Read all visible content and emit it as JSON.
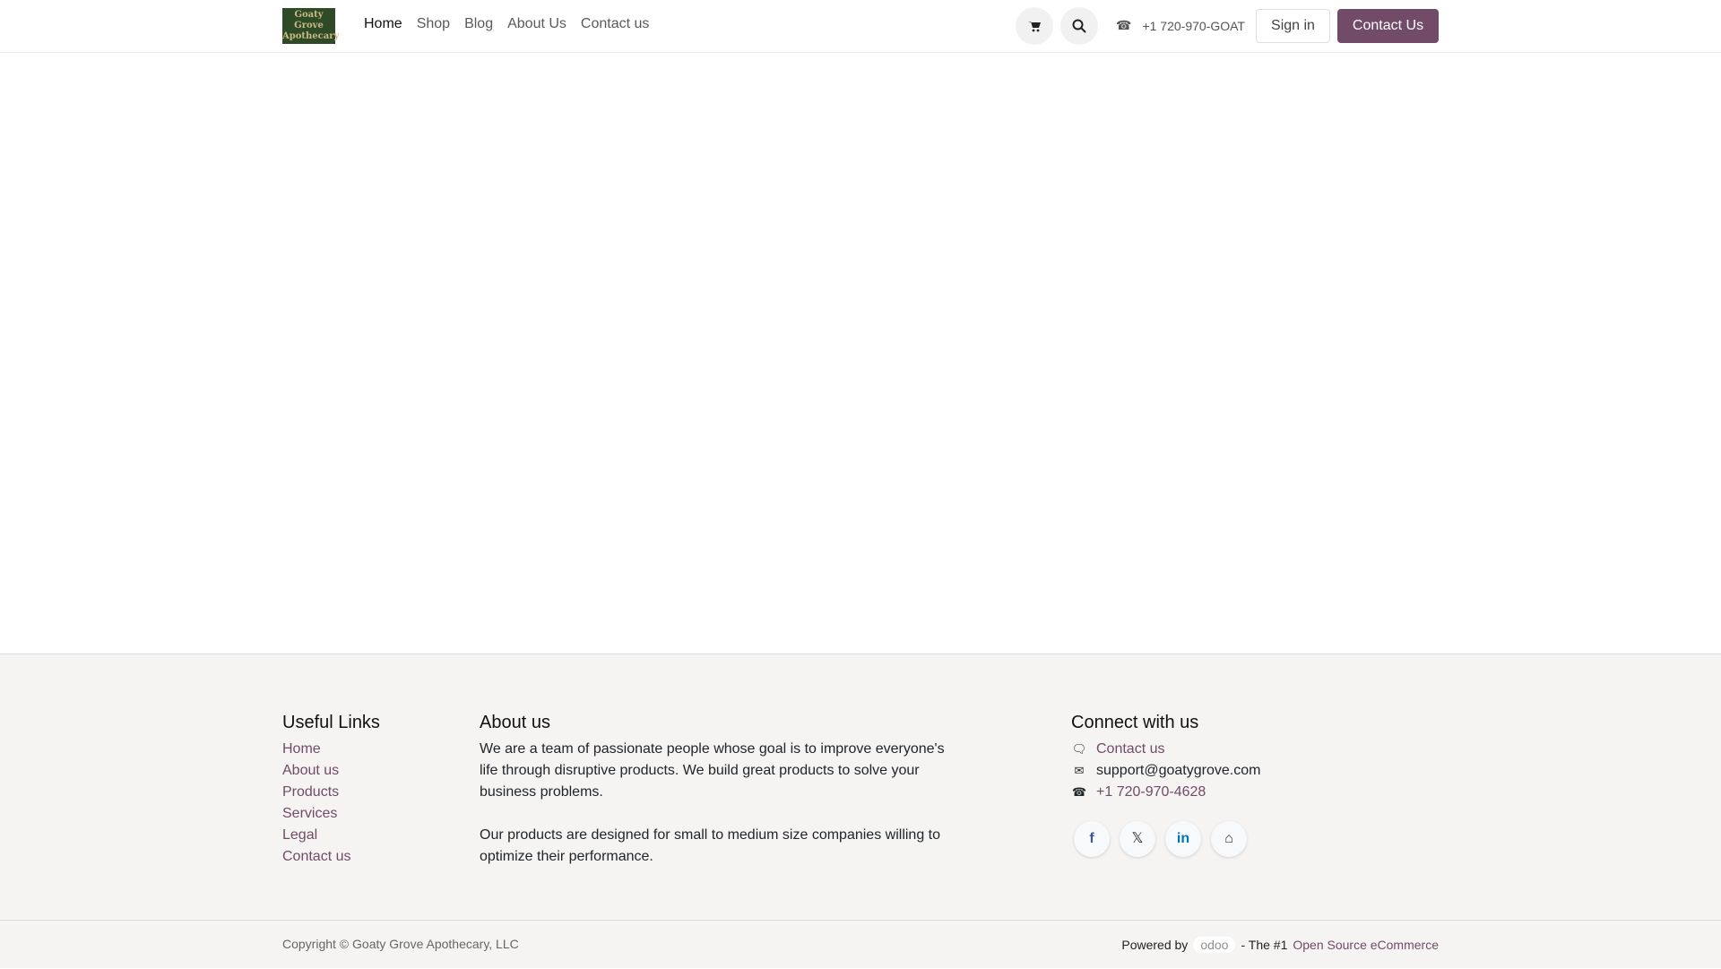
{
  "header": {
    "logo_text": "Goaty Grove Apothecary",
    "nav": [
      "Home",
      "Shop",
      "Blog",
      "About Us",
      "Contact us"
    ],
    "phone": "+1 720-970-GOAT",
    "sign_in": "Sign in",
    "contact_button": "Contact Us"
  },
  "footer": {
    "useful_links": {
      "title": "Useful Links",
      "items": [
        "Home",
        "About us",
        "Products",
        "Services",
        "Legal",
        "Contact us"
      ]
    },
    "about": {
      "title": "About us",
      "p1": "We are a team of passionate people whose goal is to improve everyone's life through disruptive products. We build great products to solve your business problems.",
      "p2": "Our products are designed for small to medium size companies willing to optimize their performance."
    },
    "connect": {
      "title": "Connect with us",
      "contact": "Contact us",
      "email": "support@goatygrove.com",
      "phone": "+1 720-970-4628"
    },
    "copyright": "Copyright © Goaty Grove Apothecary, LLC",
    "powered_by": "Powered by",
    "odoo": "odoo",
    "tagline": "- The #1",
    "tagline_link": "Open Source eCommerce"
  },
  "colors": {
    "brand": "#714b67"
  }
}
